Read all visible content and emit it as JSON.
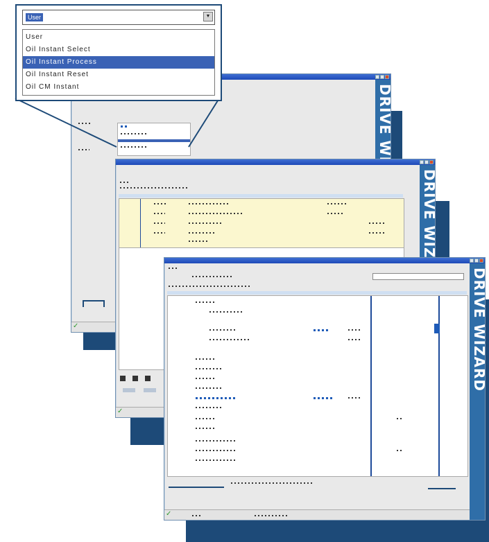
{
  "brand": {
    "text": "DRIVE WIZARD"
  },
  "callout": {
    "combo_value": "User",
    "options": [
      "User",
      "Oil Instant Select",
      "Oil Instant Process",
      "Oil Instant Reset",
      "Oil CM Instant"
    ],
    "selected_index": 2
  },
  "windows": {
    "back": {
      "title": ""
    },
    "middle": {
      "title": ""
    },
    "front": {
      "title": ""
    }
  },
  "colors": {
    "brand_blue": "#2f6ea8",
    "shadow_blue": "#1d4a78",
    "selection": "#3a62b5",
    "highlight_yellow": "#fbf7cf"
  }
}
